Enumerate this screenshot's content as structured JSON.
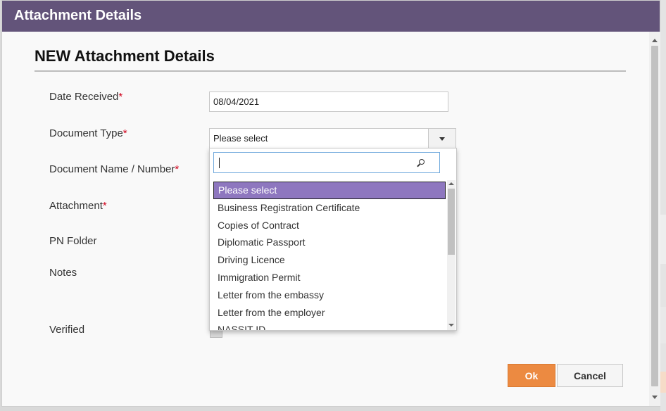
{
  "dialog": {
    "title": "Attachment Details",
    "section_title": "NEW Attachment Details"
  },
  "form": {
    "date_received": {
      "label": "Date Received",
      "value": "08/04/2021"
    },
    "document_type": {
      "label": "Document Type",
      "selected": "Please select"
    },
    "document_name": {
      "label": "Document Name / Number"
    },
    "attachment": {
      "label": "Attachment"
    },
    "pn_folder": {
      "label": "PN Folder"
    },
    "notes": {
      "label": "Notes"
    },
    "verified": {
      "label": "Verified"
    },
    "required_marker": "*"
  },
  "dropdown": {
    "search_value": "",
    "options": [
      "Please select",
      "Business Registration Certificate",
      "Copies of Contract",
      "Diplomatic Passport",
      "Driving Licence",
      "Immigration Permit",
      "Letter from the embassy",
      "Letter from the employer",
      "NASSIT ID"
    ],
    "selected_option": "Please select"
  },
  "buttons": {
    "ok": "Ok",
    "cancel": "Cancel"
  },
  "colors": {
    "titlebar": "#63547a",
    "selected_option": "#8e77bf",
    "ok_button": "#ec8a41",
    "required": "#d0021b"
  }
}
